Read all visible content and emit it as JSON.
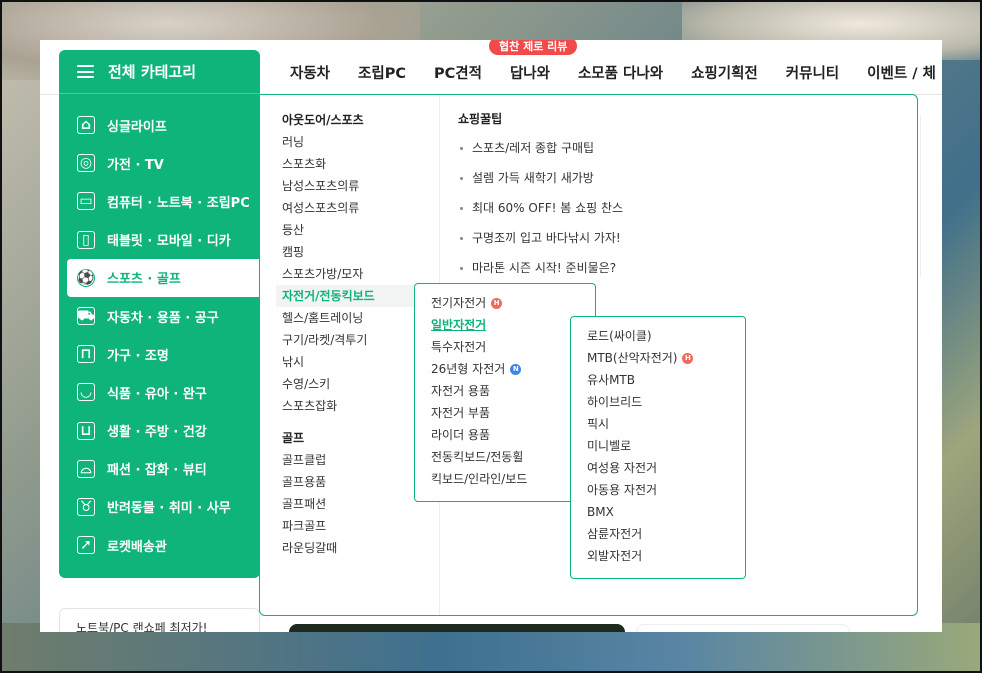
{
  "category": {
    "title": "전체 카테고리",
    "items": [
      {
        "label": "싱글라이프",
        "icon": "home-icon"
      },
      {
        "label": "가전 · TV",
        "icon": "washer-icon"
      },
      {
        "label": "컴퓨터 · 노트북 · 조립PC",
        "icon": "laptop-icon"
      },
      {
        "label": "태블릿 · 모바일 · 디카",
        "icon": "mobile-icon"
      },
      {
        "label": "스포츠 · 골프",
        "icon": "soccer-ball-icon",
        "active": true
      },
      {
        "label": "자동차 · 용품 · 공구",
        "icon": "car-icon"
      },
      {
        "label": "가구 · 조명",
        "icon": "sofa-icon"
      },
      {
        "label": "식품 · 유아 · 완구",
        "icon": "bowl-icon"
      },
      {
        "label": "생활 · 주방 · 건강",
        "icon": "pot-icon"
      },
      {
        "label": "패션 · 잡화 · 뷰티",
        "icon": "sneaker-icon"
      },
      {
        "label": "반려동물 · 취미 · 사무",
        "icon": "dog-icon"
      },
      {
        "label": "로켓배송관",
        "icon": "rocket-icon"
      }
    ]
  },
  "nav": {
    "items": [
      "자동차",
      "조립PC",
      "PC견적",
      "답나와",
      "소모품 다나와",
      "쇼핑기획전",
      "커뮤니티",
      "이벤트 / 체"
    ],
    "badge": "협찬 제로 리뷰"
  },
  "mega": {
    "outdoor_title": "아웃도어/스포츠",
    "outdoor_items": [
      "러닝",
      "스포츠화",
      "남성스포츠의류",
      "여성스포츠의류",
      "등산",
      "캠핑",
      "스포츠가방/모자",
      "자전거/전동킥보드",
      "헬스/홈트레이닝",
      "구기/라켓/격투기",
      "낚시",
      "수영/스키",
      "스포츠잡화"
    ],
    "golf_title": "골프",
    "golf_items": [
      "골프클럽",
      "골프용품",
      "골프패션",
      "파크골프",
      "라운딩갈때"
    ],
    "tips_title": "쇼핑꿀팁",
    "tips": [
      "스포츠/레저 종합 구매팁",
      "설렘 가득 새학기 새가방",
      "최대 60% OFF! 봄 쇼핑 찬스",
      "구명조끼 입고 바다낚시 가자!",
      "마라톤 시즌 시작! 준비물은?"
    ]
  },
  "bike_popup": {
    "items": [
      {
        "label": "전기자전거",
        "tag": "H"
      },
      {
        "label": "일반자전거",
        "selected": true
      },
      {
        "label": "특수자전거"
      },
      {
        "label": "26년형 자전거",
        "tag": "N"
      },
      {
        "label": "자전거 용품"
      },
      {
        "label": "자전거 부품"
      },
      {
        "label": "라이더 용품"
      },
      {
        "label": "전동킥보드/전동휠"
      },
      {
        "label": "킥보드/인라인/보드"
      }
    ]
  },
  "general_popup": {
    "items": [
      {
        "label": "로드(싸이클)"
      },
      {
        "label": "MTB(산악자전거)",
        "tag": "H"
      },
      {
        "label": "유사MTB"
      },
      {
        "label": "하이브리드"
      },
      {
        "label": "픽시"
      },
      {
        "label": "미니벨로"
      },
      {
        "label": "여성용 자전거"
      },
      {
        "label": "아동용 자전거"
      },
      {
        "label": "BMX"
      },
      {
        "label": "삼륜자전거"
      },
      {
        "label": "외발자전거"
      }
    ]
  },
  "behind": {
    "left_box": "노트북/PC 랜쇼페 최저가!"
  }
}
